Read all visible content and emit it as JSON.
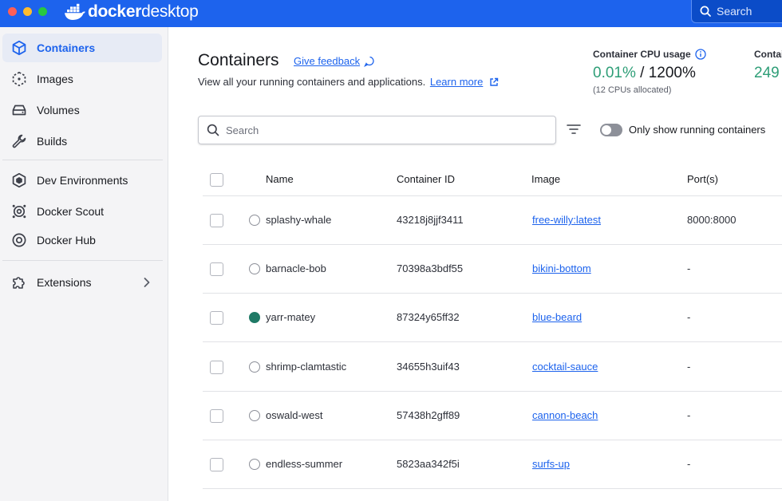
{
  "app": {
    "brand_bold": "docker",
    "brand_light": "desktop",
    "search_label": "Search"
  },
  "sidebar": {
    "items": [
      {
        "label": "Containers",
        "icon": "container-icon",
        "active": true
      },
      {
        "label": "Images",
        "icon": "image-icon"
      },
      {
        "label": "Volumes",
        "icon": "volume-icon"
      },
      {
        "label": "Builds",
        "icon": "wrench-icon"
      },
      {
        "label": "Dev Environments",
        "icon": "dev-environments-icon"
      },
      {
        "label": "Docker Scout",
        "icon": "scout-icon"
      },
      {
        "label": "Docker Hub",
        "icon": "hub-icon"
      },
      {
        "label": "Extensions",
        "icon": "puzzle-icon"
      }
    ]
  },
  "header": {
    "title": "Containers",
    "feedback_label": "Give feedback",
    "subtitle": "View all your running containers and applications.",
    "learn_more": "Learn more"
  },
  "stats": {
    "cpu_label": "Container CPU usage",
    "cpu_used": "0.01%",
    "cpu_total": " / 1200%",
    "cpu_sub": "(12 CPUs allocated)",
    "mem_label": "Contai",
    "mem_value": "249"
  },
  "toolbar": {
    "search_placeholder": "Search",
    "toggle_label": "Only show running containers"
  },
  "table": {
    "columns": [
      "Name",
      "Container ID",
      "Image",
      "Port(s)"
    ],
    "rows": [
      {
        "name": "splashy-whale",
        "id": "43218j8jjf3411",
        "image": "free-willy:latest",
        "ports": "8000:8000",
        "running": false
      },
      {
        "name": "barnacle-bob",
        "id": "70398a3bdf55",
        "image": "bikini-bottom",
        "ports": "-",
        "running": false
      },
      {
        "name": "yarr-matey",
        "id": "87324y65ff32",
        "image": "blue-beard",
        "ports": "-",
        "running": true
      },
      {
        "name": "shrimp-clamtastic",
        "id": "34655h3uif43",
        "image": "cocktail-sauce",
        "ports": "-",
        "running": false
      },
      {
        "name": "oswald-west",
        "id": "57438h2gff89",
        "image": "cannon-beach",
        "ports": "-",
        "running": false
      },
      {
        "name": "endless-summer",
        "id": "5823aa342f5i",
        "image": "surfs-up",
        "ports": "-",
        "running": false
      }
    ]
  },
  "colors": {
    "accent": "#1d63ed",
    "running": "#1f7a66",
    "cpu_green": "#2e9e77"
  }
}
